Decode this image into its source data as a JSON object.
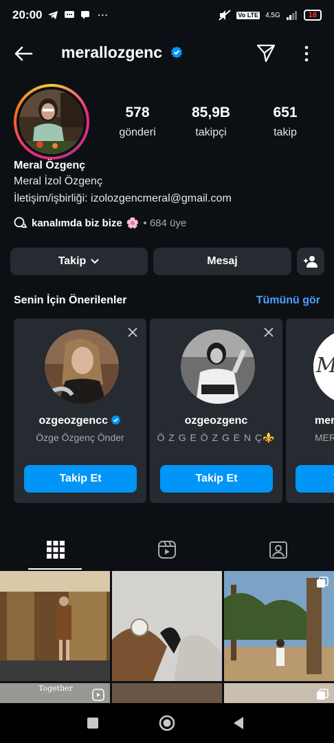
{
  "status_bar": {
    "time": "20:00",
    "network": "4,5G",
    "battery": "16",
    "chip": "Vo LTE"
  },
  "header": {
    "username": "merallozgenc",
    "icons": [
      "back-arrow-icon",
      "verified-badge-icon",
      "direct-send-icon",
      "more-vertical-icon"
    ]
  },
  "profile": {
    "posts_count": "578",
    "posts_label": "gönderi",
    "followers_count": "85,9B",
    "followers_label": "takipçi",
    "following_count": "651",
    "following_label": "takip",
    "full_name": "Meral Özgenç",
    "bio_line1": "Meral İzol Özgenç",
    "bio_line2": "İletişim/işbirliği: izolozgencmeral@gmail.com",
    "channel_name": "kanalımda biz bize",
    "channel_emoji": "🌸",
    "channel_members": "• 684 üye"
  },
  "actions": {
    "follow_label": "Takip",
    "message_label": "Mesaj"
  },
  "suggestions": {
    "title": "Senin İçin Önerilenler",
    "see_all": "Tümünü gör",
    "cards": [
      {
        "username": "ozgeozgencc",
        "subtitle": "Özge Özgenç Önder",
        "button": "Takip Et",
        "verified": true
      },
      {
        "username": "ozgeozgenc",
        "subtitle": "Ö Z G E  Ö Z G E N Ç⚜️",
        "button": "Takip Et",
        "verified": false
      },
      {
        "username": "mer",
        "subtitle": "MER",
        "button": "T",
        "verified": false
      }
    ]
  },
  "tabs": [
    "grid-icon",
    "reels-icon",
    "tagged-icon"
  ],
  "grid_overlay_text": "Together",
  "colors": {
    "background": "#0c1014",
    "button_bg": "#262a31",
    "accent_blue": "#0095f6",
    "link_blue": "#4aa3ff"
  }
}
